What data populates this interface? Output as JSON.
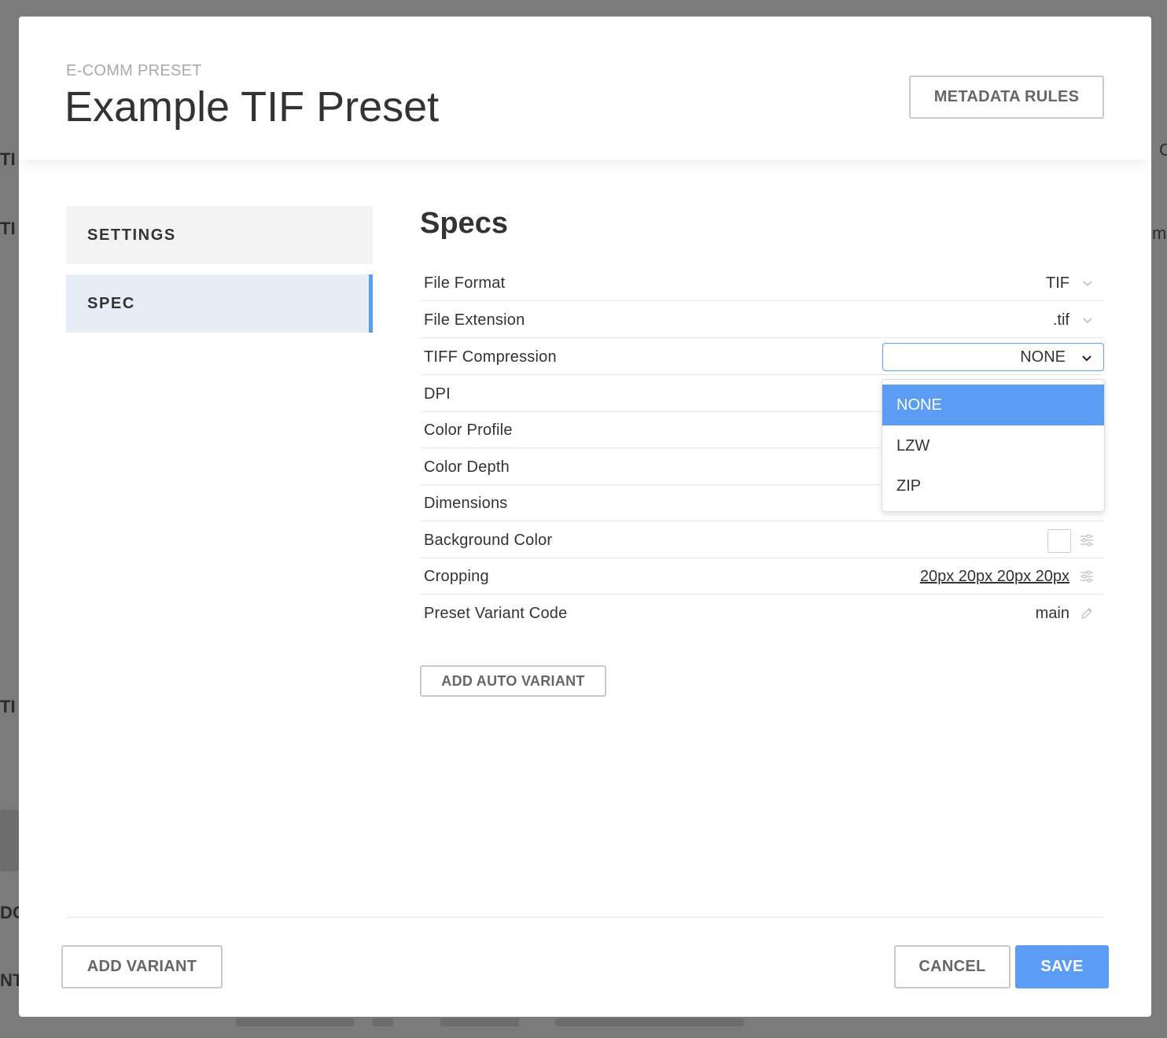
{
  "background": {
    "fragments": [
      "TI",
      "TI",
      "TI",
      "DO",
      "NT",
      "C",
      "m"
    ]
  },
  "header": {
    "eyebrow": "E-COMM PRESET",
    "title": "Example TIF Preset",
    "metadata_button": "METADATA RULES"
  },
  "nav": {
    "items": [
      {
        "label": "SETTINGS"
      },
      {
        "label": "SPEC"
      }
    ]
  },
  "specs": {
    "title": "Specs",
    "rows": [
      {
        "label": "File Format",
        "value": "TIF"
      },
      {
        "label": "File Extension",
        "value": ".tif"
      },
      {
        "label": "TIFF Compression",
        "value": "NONE"
      },
      {
        "label": "DPI",
        "value": ""
      },
      {
        "label": "Color Profile",
        "value": ""
      },
      {
        "label": "Color Depth",
        "value": ""
      },
      {
        "label": "Dimensions",
        "value": ""
      },
      {
        "label": "Background Color",
        "value": ""
      },
      {
        "label": "Cropping",
        "value": "20px 20px 20px 20px"
      },
      {
        "label": "Preset Variant Code",
        "value": "main"
      }
    ],
    "compression_options": [
      "NONE",
      "LZW",
      "ZIP"
    ],
    "selected_compression": "NONE",
    "background_swatch_color": "#ffffff",
    "add_auto_variant": "ADD AUTO VARIANT"
  },
  "footer": {
    "add_variant": "ADD VARIANT",
    "cancel": "CANCEL",
    "save": "SAVE"
  },
  "colors": {
    "accent": "#5b9df5",
    "nav_active_bg": "#e6edf5"
  },
  "icons": [
    "chevron-down-icon",
    "sliders-icon",
    "pencil-icon"
  ]
}
